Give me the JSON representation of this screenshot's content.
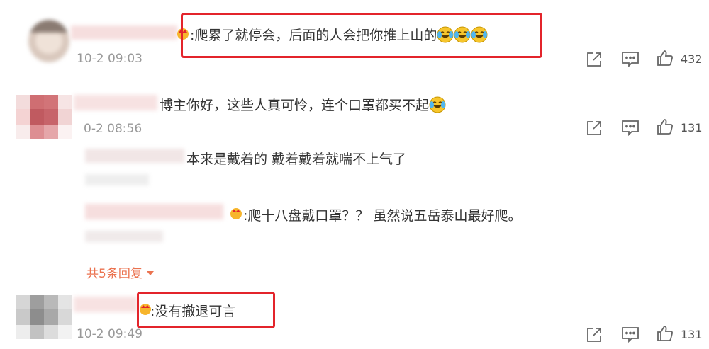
{
  "comments": [
    {
      "text": ":爬累了就停会，后面的人会把你推上山的",
      "time": "10-2 09:03",
      "like_count": "432"
    },
    {
      "text": "博主你好，这些人真可怜，连个口罩都买不起",
      "time": "0-2 08:56",
      "like_count": "131",
      "replies": [
        {
          "text": "本来是戴着的 戴着戴着就喘不上气了"
        },
        {
          "text": ":爬十八盘戴口罩？？ 虽然说五岳泰山最好爬。"
        }
      ],
      "more_replies": "共5条回复"
    },
    {
      "text": ":没有撤退可言",
      "time": "10-2 09:49",
      "like_count": "131"
    }
  ],
  "colors": {
    "highlight_box": "#e3242b",
    "more_link": "#eb7350",
    "timestamp": "#999999"
  },
  "icons": [
    "share-icon",
    "comment-icon",
    "like-icon",
    "laughing-crying-emoji",
    "crown-badge-icon",
    "chevron-down-icon"
  ]
}
